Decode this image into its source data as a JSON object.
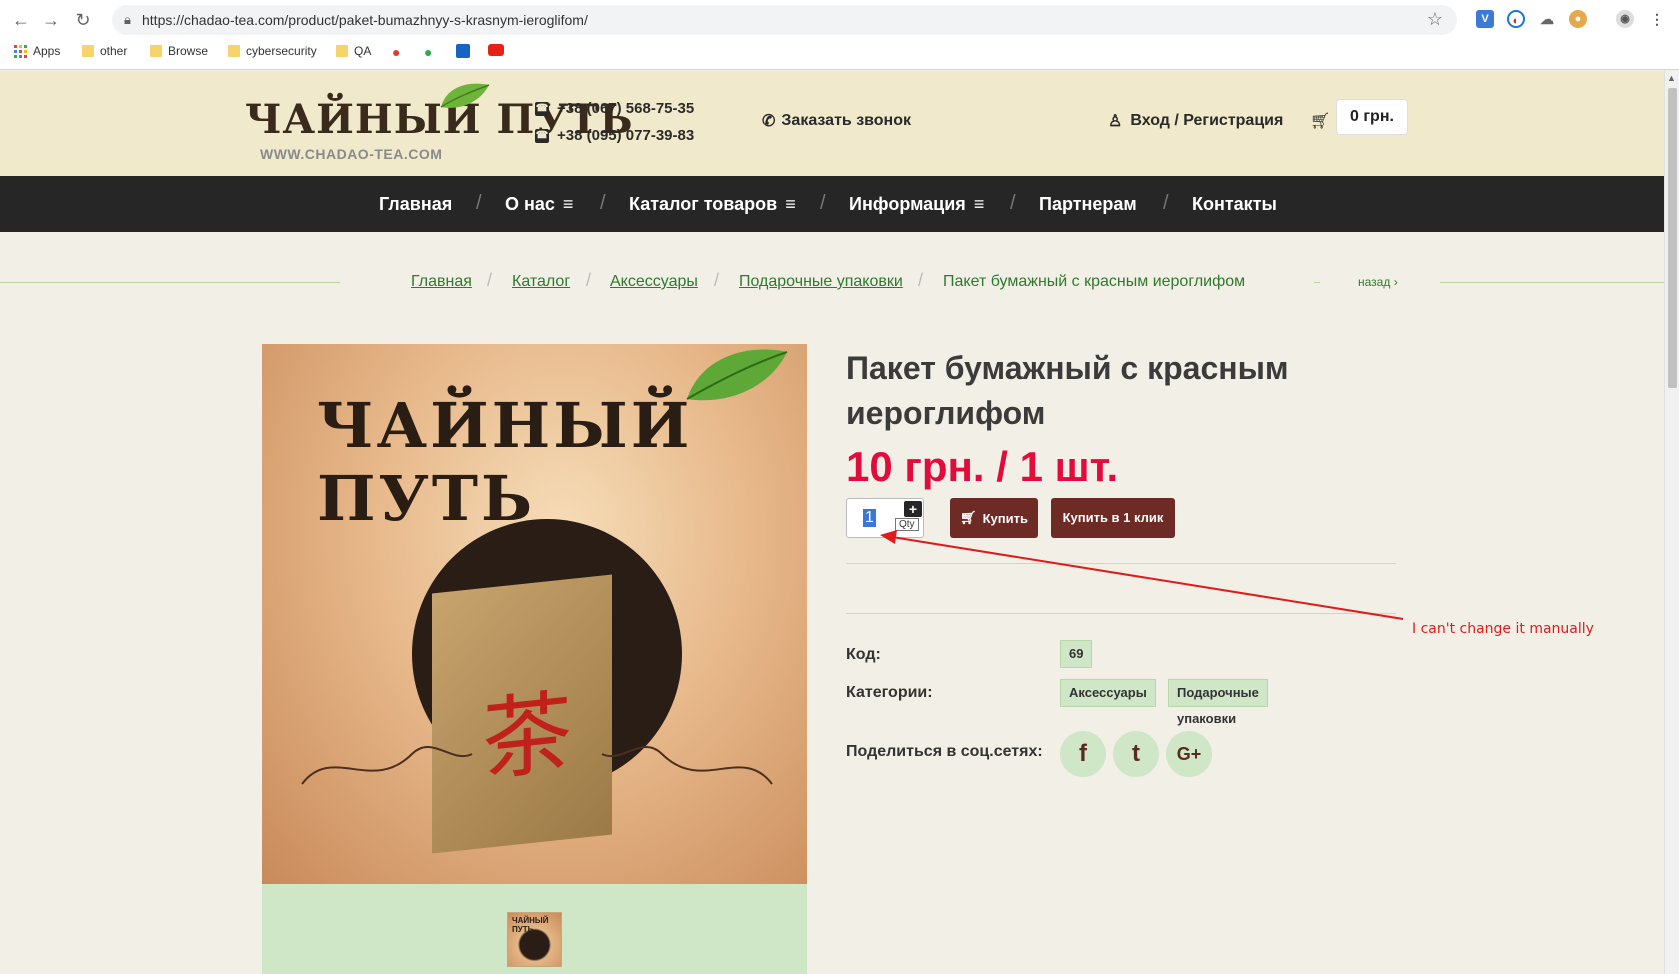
{
  "browser": {
    "url": "https://chadao-tea.com/product/paket-bumazhnyy-s-krasnym-ieroglifom/",
    "bookmarks": [
      "Apps",
      "other",
      "Browse",
      "cybersecurity",
      "QA"
    ]
  },
  "header": {
    "logo_text": "ЧАЙНЫЙ ПУТЬ",
    "logo_url": "WWW.CHADAO-TEA.COM",
    "phone1": "+38 (067) 568-75-35",
    "phone2": "+38 (095) 077-39-83",
    "callback": "Заказать звонок",
    "login": "Вход / Регистрация",
    "cart_total": "0 грн."
  },
  "nav": {
    "items": [
      "Главная",
      "О нас",
      "Каталог товаров",
      "Информация",
      "Партнерам",
      "Контакты"
    ]
  },
  "breadcrumb": {
    "items": [
      "Главная",
      "Каталог",
      "Аксессуары",
      "Подарочные упаковки"
    ],
    "current": "Пакет бумажный с красным иероглифом",
    "back": "назад"
  },
  "product": {
    "title": "Пакет бумажный с красным иероглифом",
    "price": "10 грн. / 1 шт.",
    "qty": "1",
    "qty_tooltip": "Qty",
    "buy_label": "Купить",
    "buy_one_click_label": "Купить в 1 клик",
    "code_label": "Код:",
    "code_value": "69",
    "categories_label": "Категории:",
    "categories": [
      "Аксессуары",
      "Подарочные упаковки"
    ],
    "share_label": "Поделиться в соц.сетях:",
    "image_title": "ЧАЙНЫЙ ПУТЬ",
    "thumb_text": "ЧАЙНЫЙ ПУТЬ"
  },
  "annotation": {
    "text": "I can't change it manually",
    "color": "#e01b1b"
  },
  "colors": {
    "header_bg": "#f1e9cb",
    "nav_bg": "#262626",
    "price": "#e30b3c",
    "button": "#6e2a24",
    "link": "#2f7a2f"
  }
}
